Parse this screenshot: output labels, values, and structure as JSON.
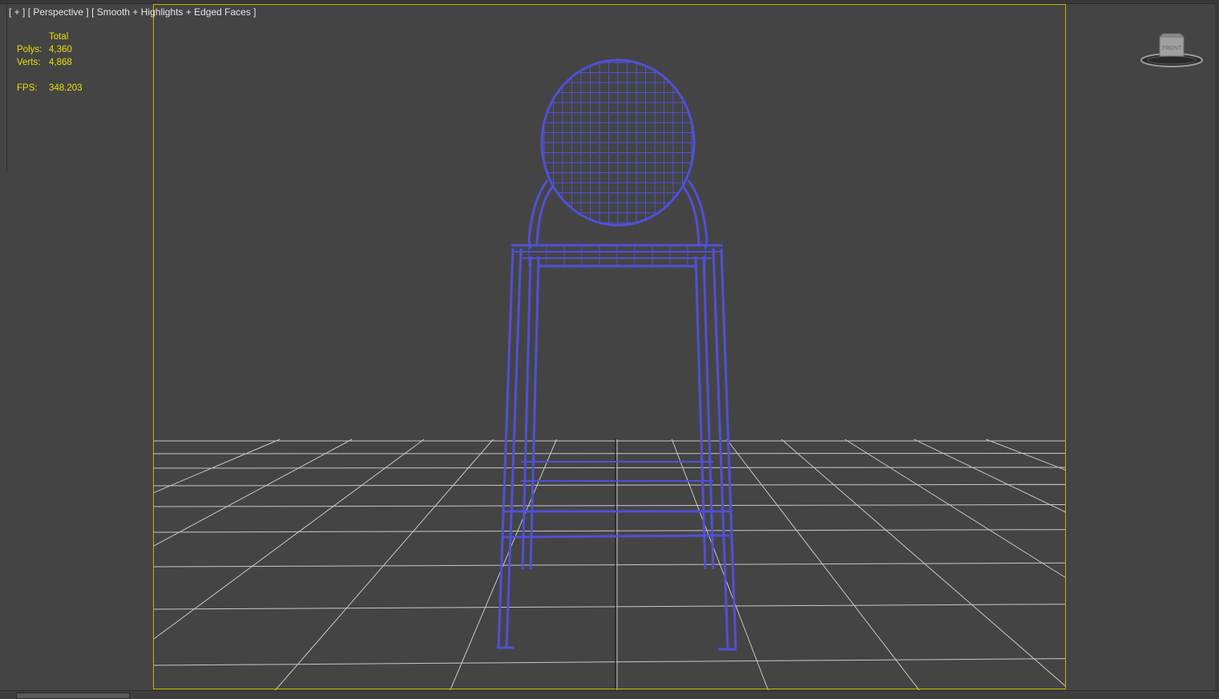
{
  "viewport": {
    "menu_plus": "[ + ]",
    "menu_view": "[ Perspective ]",
    "menu_shading": "[ Smooth + Highlights + Edged Faces ]"
  },
  "stats": {
    "header": "Total",
    "polys_label": "Polys:",
    "polys_value": "4,360",
    "verts_label": "Verts:",
    "verts_value": "4,868",
    "fps_label": "FPS:",
    "fps_value": "348.203"
  },
  "viewcube": {
    "face_label": "FRONT"
  },
  "colors": {
    "background": "#444444",
    "grid": "#c8c8c8",
    "wireframe": "#5050d8",
    "safe_frame": "#c8b400",
    "stats_text": "#e8e000"
  }
}
